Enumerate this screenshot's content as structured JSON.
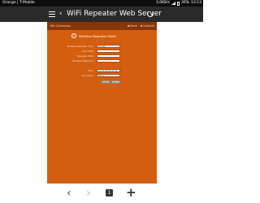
{
  "status_bar": {
    "carrier": "Orange | T-Mobile",
    "right": "3,0KB/s",
    "battery": "36%",
    "time": "13:13"
  },
  "header": {
    "title": "WiFi Repeater Web Server",
    "icons": [
      "menu-icon",
      "back-arrow-icon",
      "refresh-icon"
    ]
  },
  "page": {
    "nav_left": "Net Commands",
    "nav_right": [
      "Home",
      "Contacts"
    ],
    "form_title": "Wireless Repeater Mode",
    "fields": [
      {
        "label": "Wireless Repeater Type",
        "value": "Enable"
      },
      {
        "label": "Root SSID",
        "value": ""
      },
      {
        "label": "Repeater SSID",
        "value": ""
      },
      {
        "label": "Wireless Password",
        "value": ""
      },
      {
        "label": "MAC",
        "value": "00:00:00:00:00:00"
      },
      {
        "label": "Encryption",
        "value": "None"
      }
    ],
    "buttons": {
      "apply": "Apply",
      "cancel": "Cancel"
    }
  },
  "bottom_nav": {
    "tab_count": "1",
    "icons": [
      "back-arrow-icon",
      "forward-arrow-icon",
      "tabs-icon",
      "new-tab-icon"
    ]
  },
  "colors": {
    "page_background": "#d35e0f",
    "page_toolbar": "#8a3504",
    "app_header": "#2a2a2a",
    "status_bar": "#0d0d0d"
  }
}
